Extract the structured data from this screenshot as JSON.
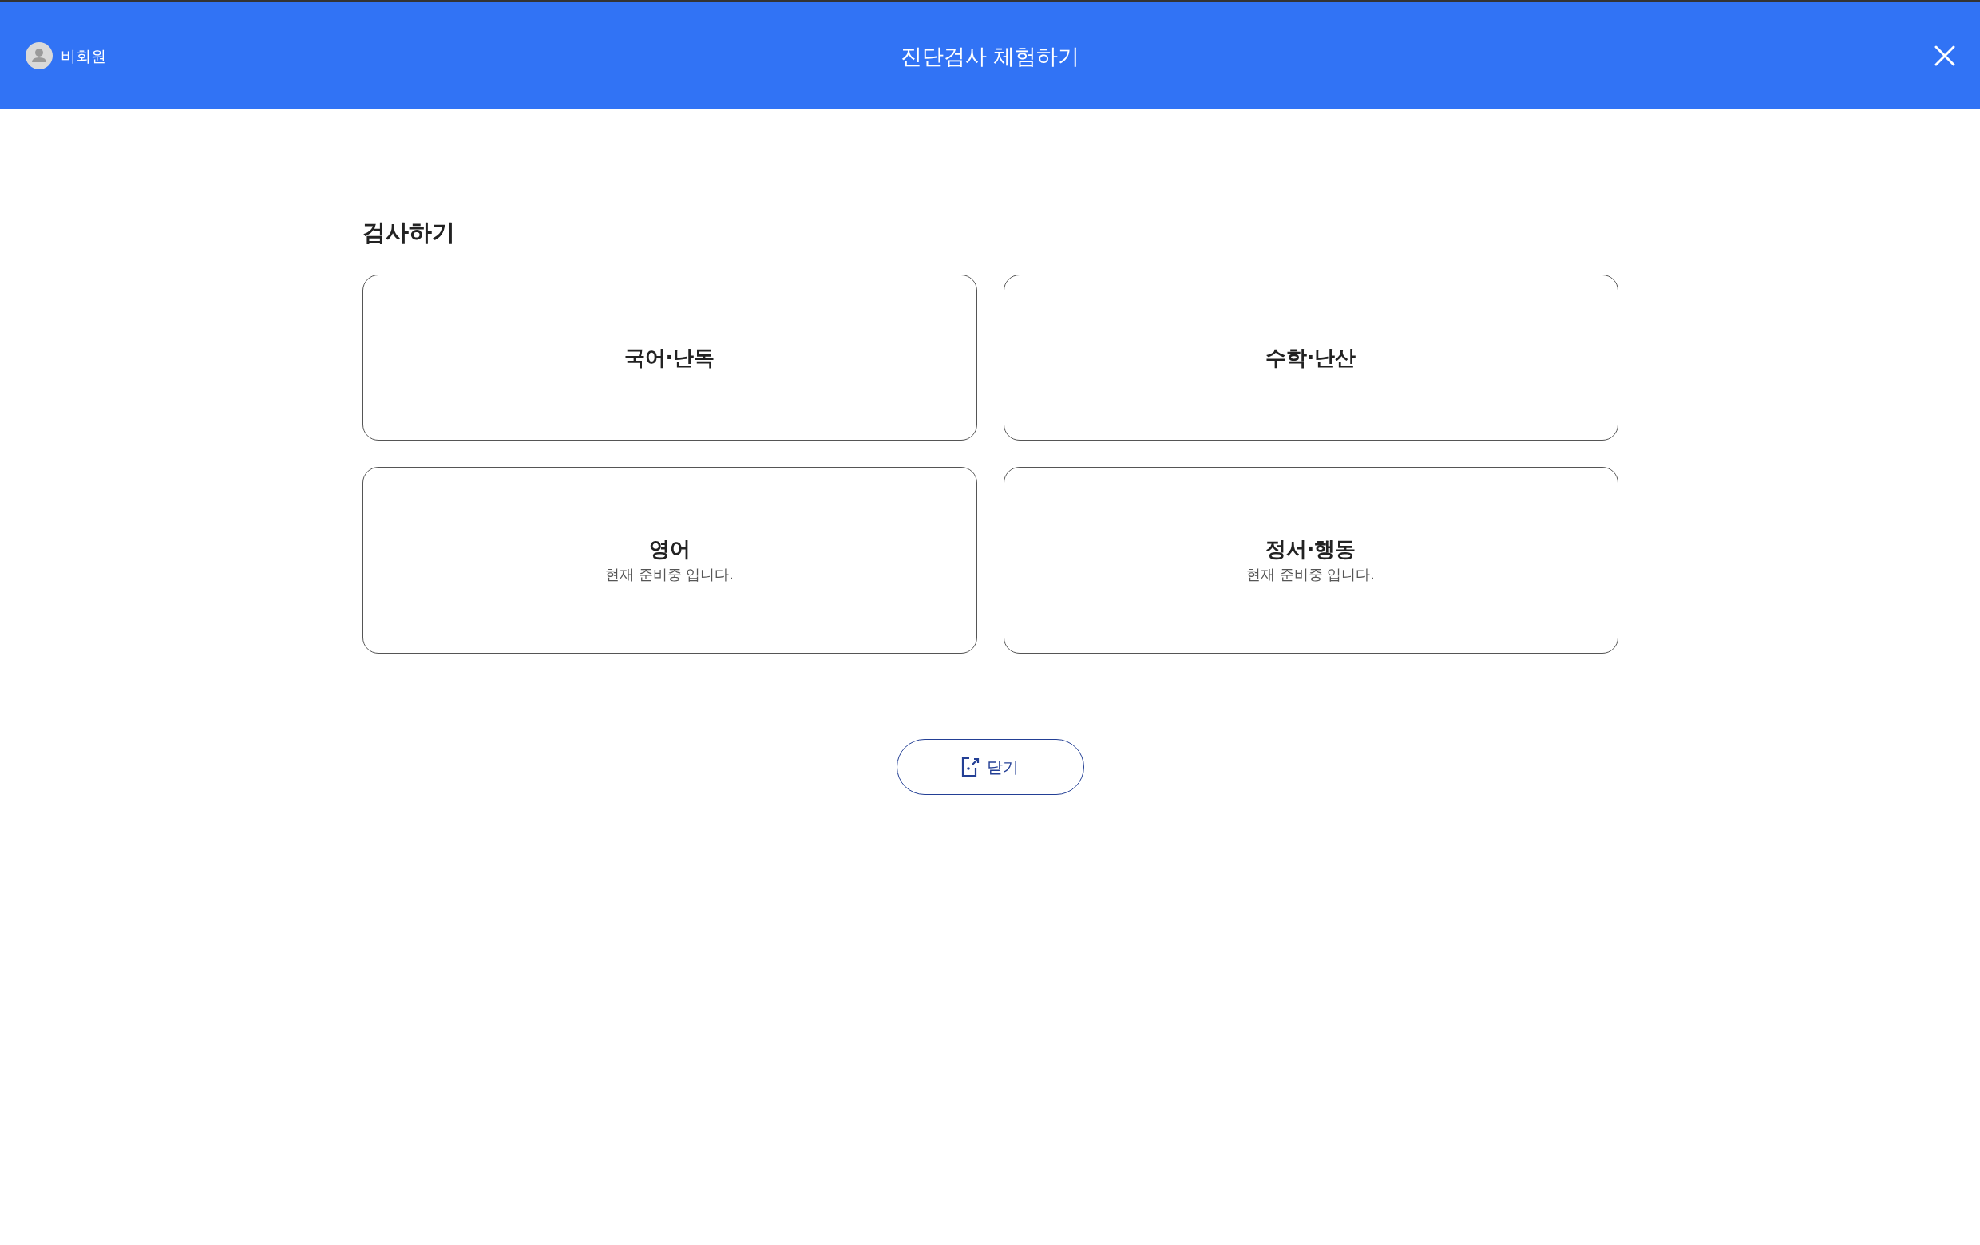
{
  "header": {
    "user": {
      "label": "비회원"
    },
    "title": "진단검사 체험하기"
  },
  "section": {
    "title": "검사하기",
    "cards": [
      {
        "title": "국어·난독"
      },
      {
        "title": "수학·난산"
      },
      {
        "title": "영어",
        "note": "현재 준비중 입니다."
      },
      {
        "title": "정서·행동",
        "note": "현재 준비중 입니다."
      }
    ]
  },
  "footer_button": {
    "label": "닫기"
  }
}
